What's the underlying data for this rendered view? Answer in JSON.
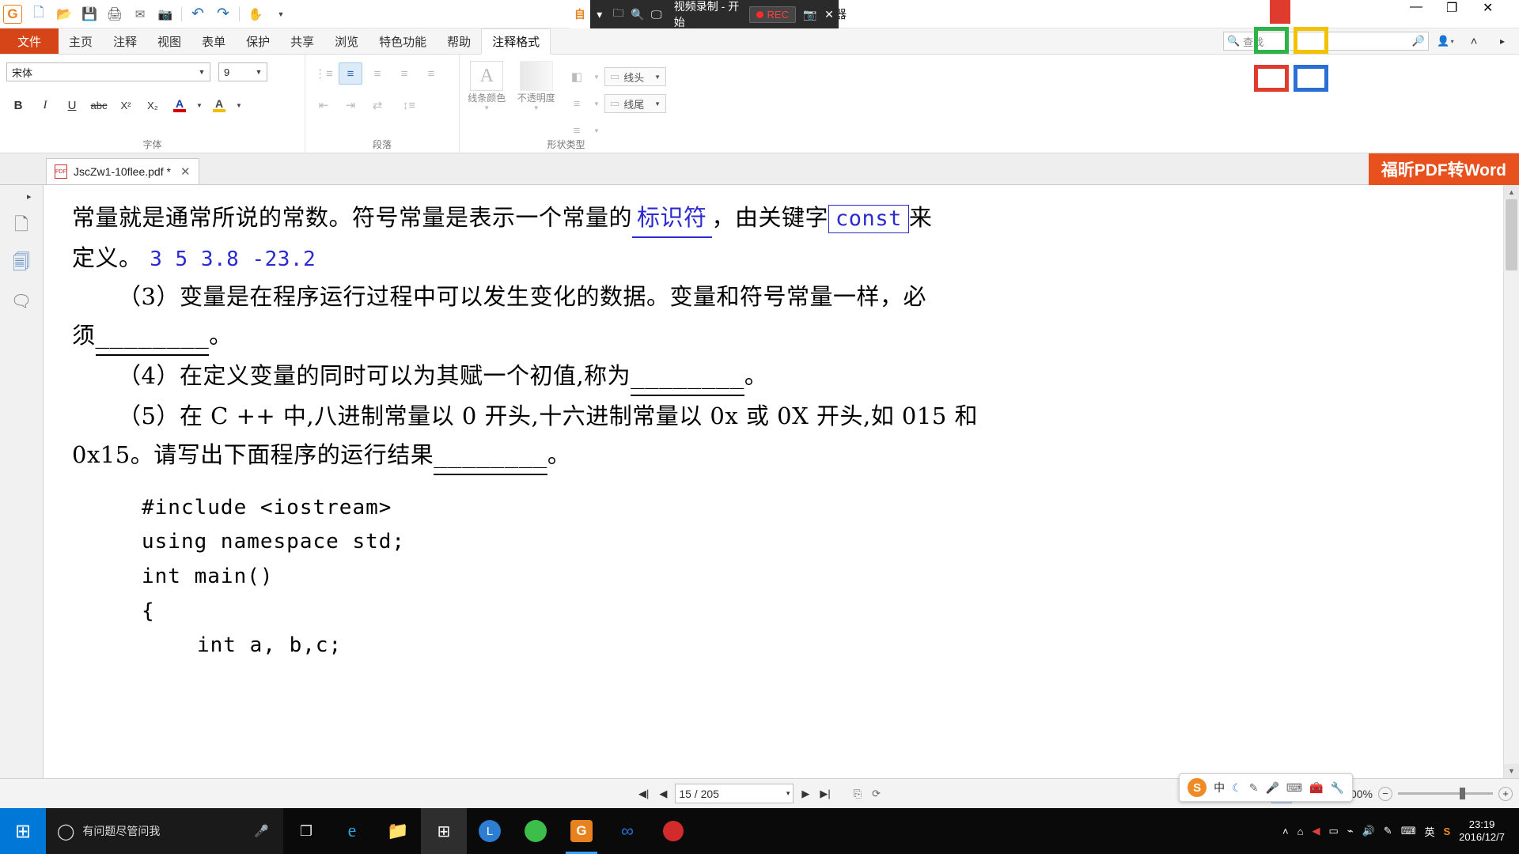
{
  "window": {
    "title": "JscZw1-10flee.pdf * - 福昕阅读器",
    "minimize_label": "—",
    "maximize_label": "❐",
    "close_label": "✕"
  },
  "quick_access": [
    {
      "name": "app-logo",
      "glyph": "G"
    },
    {
      "name": "new-button",
      "glyph": "🗋"
    },
    {
      "name": "open-button",
      "glyph": "📂"
    },
    {
      "name": "save-button",
      "glyph": "💾"
    },
    {
      "name": "print-button",
      "glyph": "🖨"
    },
    {
      "name": "email-button",
      "glyph": "✉"
    },
    {
      "name": "screenshot-button",
      "glyph": "📷"
    },
    {
      "name": "undo-button",
      "glyph": "↶"
    },
    {
      "name": "redo-button",
      "glyph": "↷"
    },
    {
      "name": "hand-tool-button",
      "glyph": "✋"
    },
    {
      "name": "customize-qat-button",
      "glyph": "▾"
    }
  ],
  "recorder": {
    "title": "视频录制 - 开始",
    "rec_label": "REC",
    "camera_glyph": "📷",
    "close_glyph": "✕",
    "dropdown_glyph": "▾",
    "search_glyph": "🔍"
  },
  "ribbon_tabs": {
    "file": "文件",
    "items": [
      "主页",
      "注释",
      "视图",
      "表单",
      "保护",
      "共享",
      "浏览",
      "特色功能",
      "帮助"
    ],
    "context_tab": "注释格式"
  },
  "ribbon_right": {
    "find_placeholder": "查找",
    "find_icon": "🔍",
    "sync_icon": "⟳",
    "user_icon": "👤",
    "collapse_icon": "˄"
  },
  "ribbon": {
    "font_group": {
      "label": "字体",
      "font_name": "宋体",
      "font_size": "9",
      "bold": "B",
      "italic": "I",
      "underline": "U",
      "strikethrough": "abc",
      "superscript": "X²",
      "subscript": "X₂",
      "font_color": "A",
      "highlight": "A"
    },
    "paragraph_group": {
      "label": "段落",
      "bullets": "⋮≡",
      "numbering": "≣",
      "align_left": "≡",
      "align_center": "≡",
      "align_right": "≡",
      "justify": "≡",
      "decrease_indent": "⇤",
      "increase_indent": "⇥",
      "text_direction": "⇄",
      "line_spacing": "↕≡"
    },
    "shape_group": {
      "label": "形状类型",
      "line_color_label": "线条颜色",
      "opacity_label": "不透明度",
      "line_color_icon": "A",
      "opacity_icon": "▨",
      "fill_icon": "◧",
      "line_start_label": "线头",
      "line_end_label": "线尾",
      "dash_icon": "≡",
      "width_icon": "≡"
    }
  },
  "doc_tab": {
    "label": "JscZw1-10flee.pdf *",
    "close": "✕",
    "list_arrow": "▾"
  },
  "promo_banner": "福昕PDF转Word",
  "left_sidebar": {
    "collapse_arrow": "▸",
    "items": [
      {
        "name": "page-thumbnails-icon",
        "glyph": "🗋"
      },
      {
        "name": "bookmarks-icon",
        "glyph": "🗏"
      },
      {
        "name": "comments-icon",
        "glyph": "🗨"
      }
    ]
  },
  "document": {
    "lines": [
      {
        "type": "rich",
        "parts": [
          {
            "t": "常量就是通常所说的常数。符号常量是表示一个常量的",
            "style": "plain"
          },
          {
            "t": "标识符",
            "style": "blueul"
          },
          {
            "t": "，由关键字",
            "style": "plain"
          },
          {
            "t": "const",
            "style": "constbox"
          },
          {
            "t": "来",
            "style": "plain"
          }
        ]
      },
      {
        "type": "rich",
        "parts": [
          {
            "t": "定义。",
            "style": "plain"
          },
          {
            "t": "3  5  3.8  -23.2",
            "style": "bluemono"
          }
        ]
      },
      {
        "type": "plain",
        "t": "（3）变量是在程序运行过程中可以发生变化的数据。变量和符号常量一样，必"
      },
      {
        "type": "rich",
        "parts": [
          {
            "t": "须",
            "style": "plain"
          },
          {
            "t": "________",
            "style": "ul"
          },
          {
            "t": "。",
            "style": "plain"
          }
        ]
      },
      {
        "type": "rich",
        "parts": [
          {
            "t": "（4）在定义变量的同时可以为其赋一个初值,称为",
            "style": "indent"
          },
          {
            "t": "________",
            "style": "ul"
          },
          {
            "t": "。",
            "style": "plain"
          }
        ]
      },
      {
        "type": "plain_indent",
        "t": "（5）在 C ++ 中,八进制常量以 0 开头,十六进制常量以 0x 或 0X 开头,如 015 和"
      },
      {
        "type": "rich",
        "parts": [
          {
            "t": "0x15。请写出下面程序的运行结果",
            "style": "plain"
          },
          {
            "t": "________",
            "style": "ul"
          },
          {
            "t": "。",
            "style": "plain"
          }
        ]
      }
    ],
    "code_lines": [
      {
        "indent": 1,
        "t": "#include <iostream>"
      },
      {
        "indent": 1,
        "t": "using namespace std;"
      },
      {
        "indent": 1,
        "t": "int main()"
      },
      {
        "indent": 1,
        "t": "{"
      },
      {
        "indent": 2,
        "t": "int a, b,c;"
      }
    ]
  },
  "status_bar": {
    "first_page_icon": "◀|",
    "prev_page_icon": "◀",
    "page_value": "15 / 205",
    "page_dropdown": "▾",
    "next_page_icon": "▶",
    "last_page_icon": "▶|",
    "fit_page_icon": "⎘",
    "rotate_icon": "⟳",
    "view_modes": [
      {
        "name": "single-page-view",
        "glyph": "▤"
      },
      {
        "name": "continuous-view",
        "glyph": "▥"
      },
      {
        "name": "facing-view",
        "glyph": "▦"
      },
      {
        "name": "split-view",
        "glyph": "▧"
      }
    ],
    "zoom_value": "300%",
    "zoom_out": "−",
    "zoom_in": "+"
  },
  "taskbar": {
    "start_glyph": "⊞",
    "cortana_placeholder": "有问题尽管问我",
    "cortana_circle": "◯",
    "mic_glyph": "🎤",
    "taskview_glyph": "❐",
    "apps": [
      {
        "name": "taskbar-edge",
        "glyph": "e",
        "color": "#2e9fd4"
      },
      {
        "name": "taskbar-file-explorer",
        "glyph": "📁",
        "color": "#f6c04a"
      },
      {
        "name": "taskbar-store",
        "glyph": "⊞",
        "color": "#ffffff"
      },
      {
        "name": "taskbar-thunder",
        "glyph": "L",
        "color": "#2d7dd2"
      },
      {
        "name": "taskbar-green-app",
        "glyph": "●",
        "color": "#3dbd4a"
      },
      {
        "name": "taskbar-foxit-reader",
        "glyph": "G",
        "color": "#e8821e"
      },
      {
        "name": "taskbar-link-app",
        "glyph": "∞",
        "color": "#2b6fd6"
      },
      {
        "name": "taskbar-recorder",
        "glyph": "●",
        "color": "#d22b2b"
      }
    ],
    "tray": [
      {
        "name": "tray-expand-icon",
        "glyph": "˄"
      },
      {
        "name": "tray-home-icon",
        "glyph": "⌂"
      },
      {
        "name": "tray-volume-red-icon",
        "glyph": "◀"
      },
      {
        "name": "tray-battery-icon",
        "glyph": "▭"
      },
      {
        "name": "tray-wifi-icon",
        "glyph": "⌁"
      },
      {
        "name": "tray-speaker-icon",
        "glyph": "🔊"
      },
      {
        "name": "tray-pen-icon",
        "glyph": "✎"
      },
      {
        "name": "tray-keyboard-icon",
        "glyph": "⌨"
      },
      {
        "name": "tray-ime-icon",
        "glyph": "英"
      },
      {
        "name": "tray-sogou-icon",
        "glyph": "S"
      }
    ],
    "clock_time": "23:19",
    "clock_date": "2016/12/7"
  },
  "ime_bar": {
    "logo": "S",
    "mode": "中",
    "moon_glyph": "☾",
    "emoji_glyph": "✎",
    "mic_glyph": "🎤",
    "keyboard_glyph": "⌨",
    "toolbox_glyph": "🧰",
    "menu_glyph": "🔧"
  },
  "colors": {
    "file_tab": "#d64518",
    "promo": "#e8501e",
    "accent_blue": "#2a2ad0",
    "start_button": "#0078d7",
    "rec_red": "#ff2b2b"
  }
}
